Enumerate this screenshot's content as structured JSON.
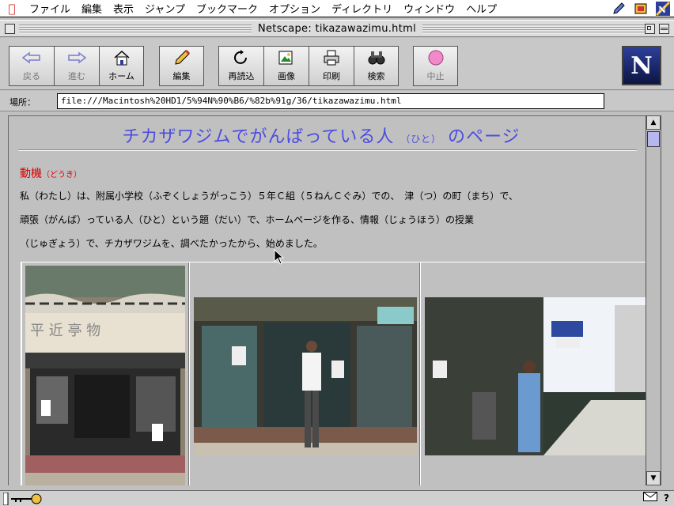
{
  "menubar": {
    "items": [
      "ファイル",
      "編集",
      "表示",
      "ジャンプ",
      "ブックマーク",
      "オプション",
      "ディレクトリ",
      "ウィンドウ",
      "ヘルプ"
    ]
  },
  "window": {
    "title": "Netscape: tikazawazimu.html"
  },
  "toolbar": {
    "back": "戻る",
    "forward": "進む",
    "home": "ホーム",
    "edit": "編集",
    "reload": "再読込",
    "images": "画像",
    "print": "印刷",
    "find": "検索",
    "stop": "中止",
    "logo": "N"
  },
  "location": {
    "label": "場所：",
    "url": "file:///Macintosh%20HD1/5%94N%90%B6/%82b%91g/36/tikazawazimu.html"
  },
  "page": {
    "title_main": "チカザワジムでがんばっている人",
    "title_ruby": "（ひと）",
    "title_end": "のページ",
    "motive_label": "動機",
    "motive_ruby": "（どうき）",
    "para1": "私（わたし）は、附属小学校（ふぞくしょうがっこう）５年Ｃ組（５ねんＣぐみ）での、　津（つ）の町（まち）で、",
    "para2": "頑張（がんば）っている人（ひと）という題（だい）で、ホームページを作る、情報（じょうほう）の授業",
    "para3": "（じゅぎょう）で、チカザワジムを、調べたかったから、始めました。"
  },
  "colors": {
    "title": "#4c4ce0",
    "motive": "#e00000",
    "scroll_thumb": "#b6b6f0"
  }
}
